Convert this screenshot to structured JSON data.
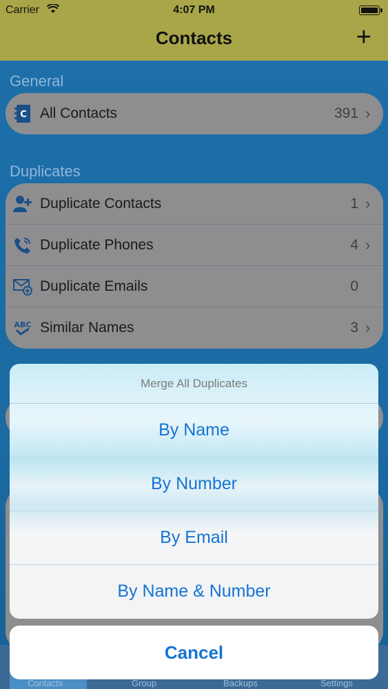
{
  "status_bar": {
    "carrier": "Carrier",
    "time": "4:07 PM"
  },
  "nav": {
    "title": "Contacts",
    "add_label": "+"
  },
  "sections": {
    "general": {
      "header": "General",
      "items": [
        {
          "label": "All Contacts",
          "count": "391",
          "chevron": "›"
        }
      ]
    },
    "duplicates": {
      "header": "Duplicates",
      "items": [
        {
          "label": "Duplicate Contacts",
          "count": "1",
          "chevron": "›"
        },
        {
          "label": "Duplicate Phones",
          "count": "4",
          "chevron": "›"
        },
        {
          "label": "Duplicate Emails",
          "count": "0",
          "chevron": ""
        },
        {
          "label": "Similar Names",
          "count": "3",
          "chevron": "›"
        }
      ]
    }
  },
  "action_sheet": {
    "title": "Merge All Duplicates",
    "options": [
      "By Name",
      "By Number",
      "By Email",
      "By Name & Number"
    ],
    "cancel": "Cancel"
  },
  "tab_bar": {
    "tabs": [
      "Contacts",
      "Group",
      "Backups",
      "Settings"
    ]
  },
  "icons": {
    "all_contacts": "address-book-icon",
    "duplicate_contacts": "add-person-icon",
    "duplicate_phones": "phone-icon",
    "duplicate_emails": "envelope-add-icon",
    "similar_names": "abc-check-icon"
  },
  "colors": {
    "nav_bar": "#a9a64a",
    "accent": "#1673d4",
    "background": "#1a6ea6"
  }
}
